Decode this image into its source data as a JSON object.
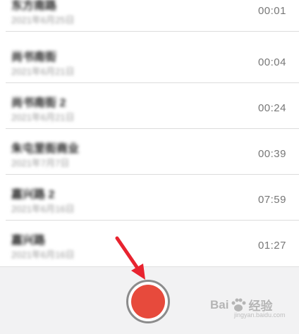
{
  "recordings": [
    {
      "name": "东方南路",
      "date": "2021年6月25日",
      "duration": "00:01"
    },
    {
      "name": "尚书南街",
      "date": "2021年6月21日",
      "duration": "00:04"
    },
    {
      "name": "尚书南街 2",
      "date": "2021年6月21日",
      "duration": "00:24"
    },
    {
      "name": "朱屯里街商业",
      "date": "2021年7月7日",
      "duration": "00:39"
    },
    {
      "name": "嘉兴路 2",
      "date": "2021年6月16日",
      "duration": "07:59"
    },
    {
      "name": "嘉兴路",
      "date": "2021年6月16日",
      "duration": "01:27"
    }
  ],
  "watermark": {
    "brand": "Bai",
    "brand_suffix": "经验",
    "url": "jingyan.baidu.com"
  },
  "colors": {
    "record": "#e74a3c",
    "annotation_arrow": "#e8232f"
  }
}
